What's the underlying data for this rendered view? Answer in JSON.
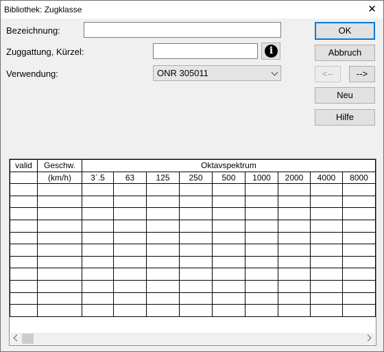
{
  "window": {
    "title": "Bibliothek: Zugklasse",
    "close_glyph": "✕"
  },
  "form": {
    "bezeichnung_label": "Bezeichnung:",
    "bezeichnung_value": "",
    "zuggattung_label": "Zuggattung, Kürzel:",
    "zuggattung_value": "",
    "info_glyph": "i",
    "verwendung_label": "Verwendung:",
    "verwendung_value": "ONR 305011"
  },
  "buttons": {
    "ok": "OK",
    "abbruch": "Abbruch",
    "prev": "<--",
    "next": "-->",
    "neu": "Neu",
    "hilfe": "Hilfe"
  },
  "table": {
    "header_valid": "valid",
    "header_speed": "Geschw.",
    "header_speed_unit": "(km/h)",
    "header_octave": "Oktavspektrum",
    "octave_bands": [
      "3`.5",
      "63",
      "125",
      "250",
      "500",
      "1000",
      "2000",
      "4000",
      "8000"
    ],
    "empty_rows": 11
  }
}
